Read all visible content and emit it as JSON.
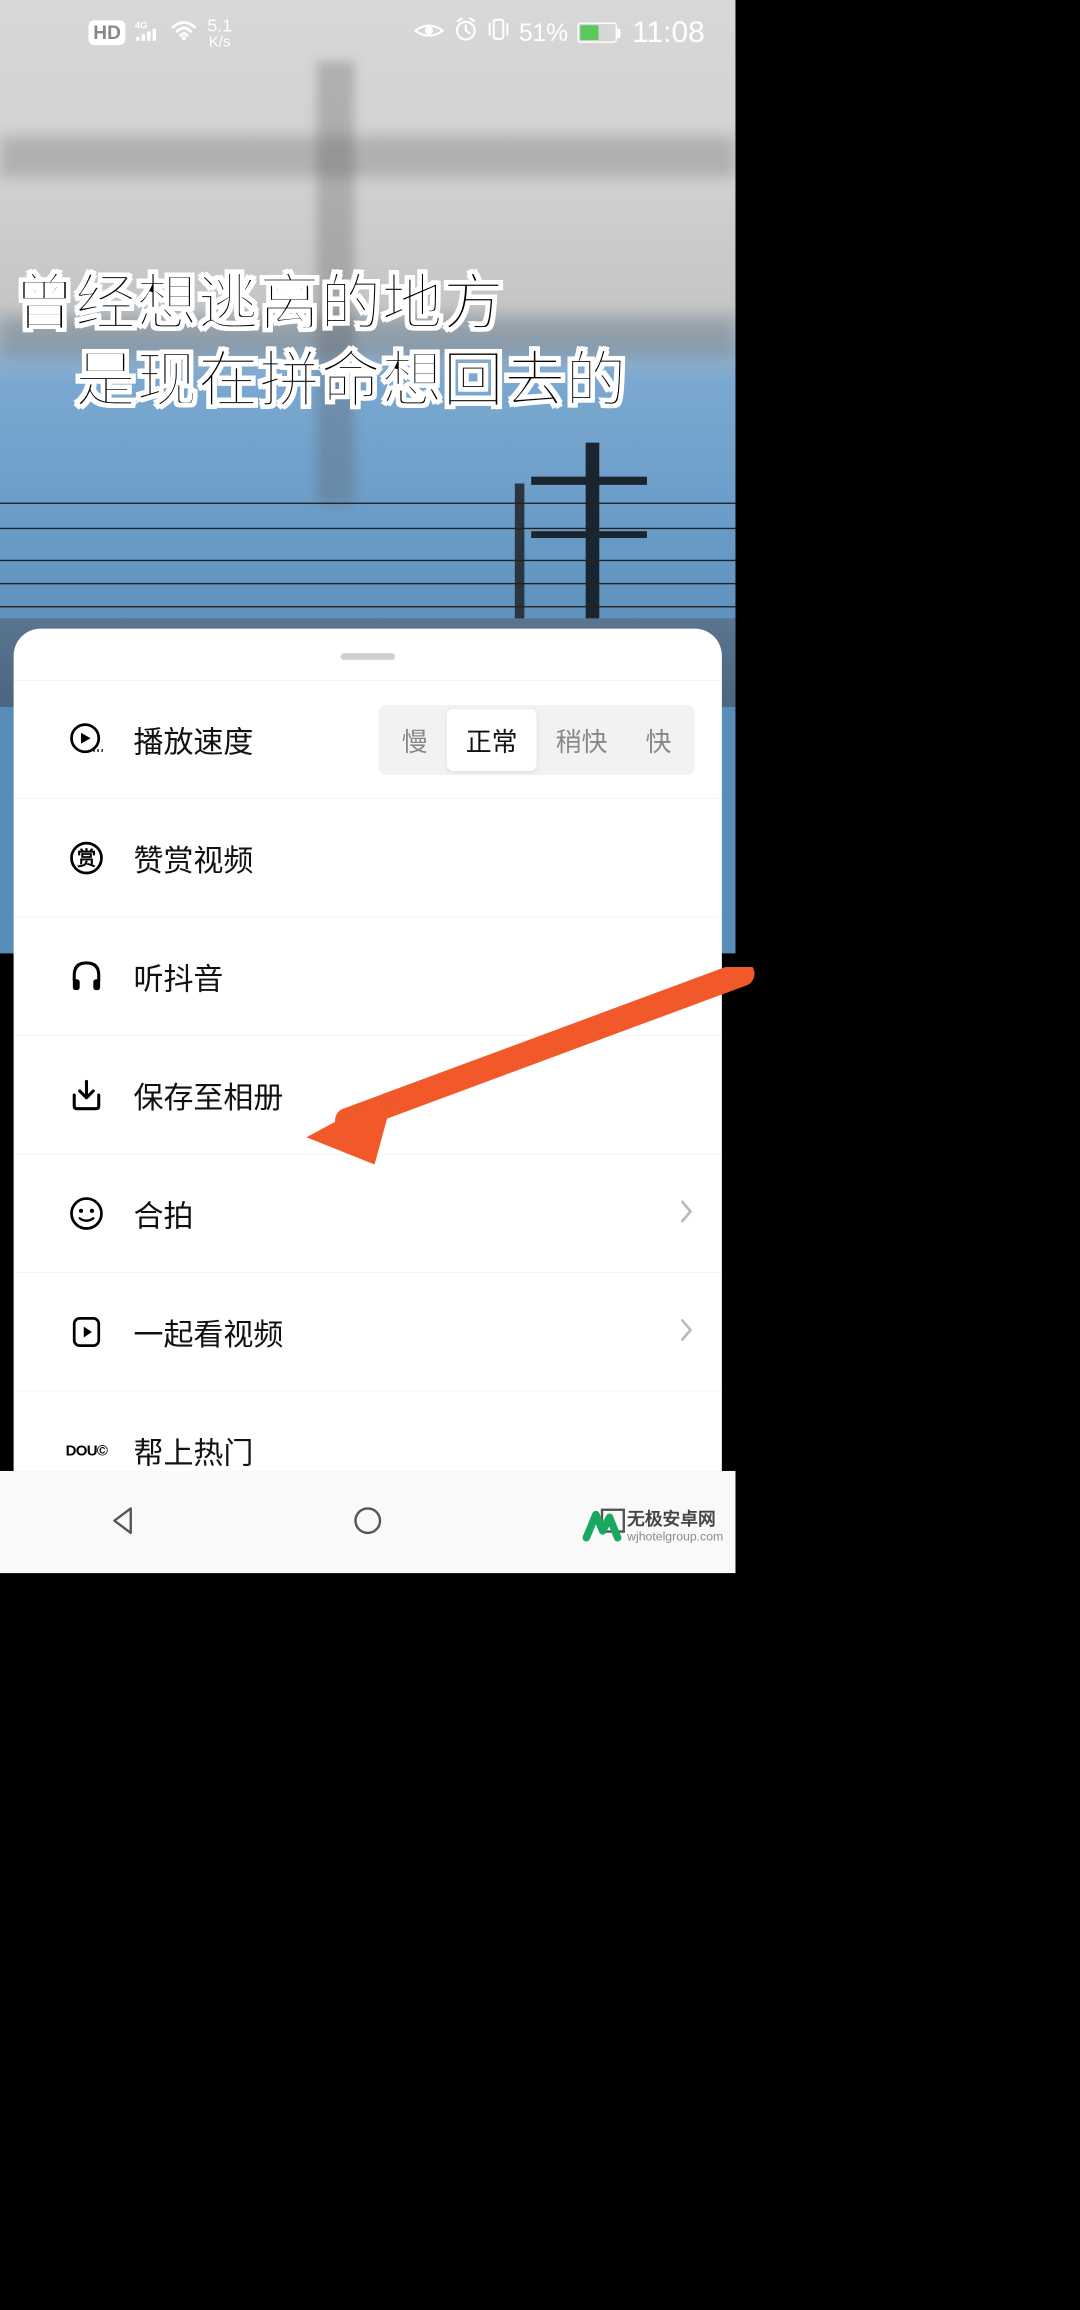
{
  "status_bar": {
    "hd": "HD",
    "signal_type": "4G",
    "net_speed": "5.1",
    "net_speed_unit": "K/s",
    "battery_pct": "51%",
    "time": "11:08"
  },
  "video_caption": {
    "line1": "曾经想逃离的地方",
    "line2": "是现在拼命想回去的"
  },
  "sheet": {
    "rows": {
      "playback_speed": "播放速度",
      "appreciate": "赞赏视频",
      "listen": "听抖音",
      "save_album": "保存至相册",
      "duet": "合拍",
      "watch_together": "一起看视频",
      "dou_hot": "帮上热门"
    },
    "speed_options": {
      "slow": "慢",
      "normal": "正常",
      "faster": "稍快",
      "fast": "快"
    },
    "dou_badge": "DOU©"
  },
  "watermark": {
    "title": "无极安卓网",
    "sub": "wjhotelgroup.com"
  }
}
